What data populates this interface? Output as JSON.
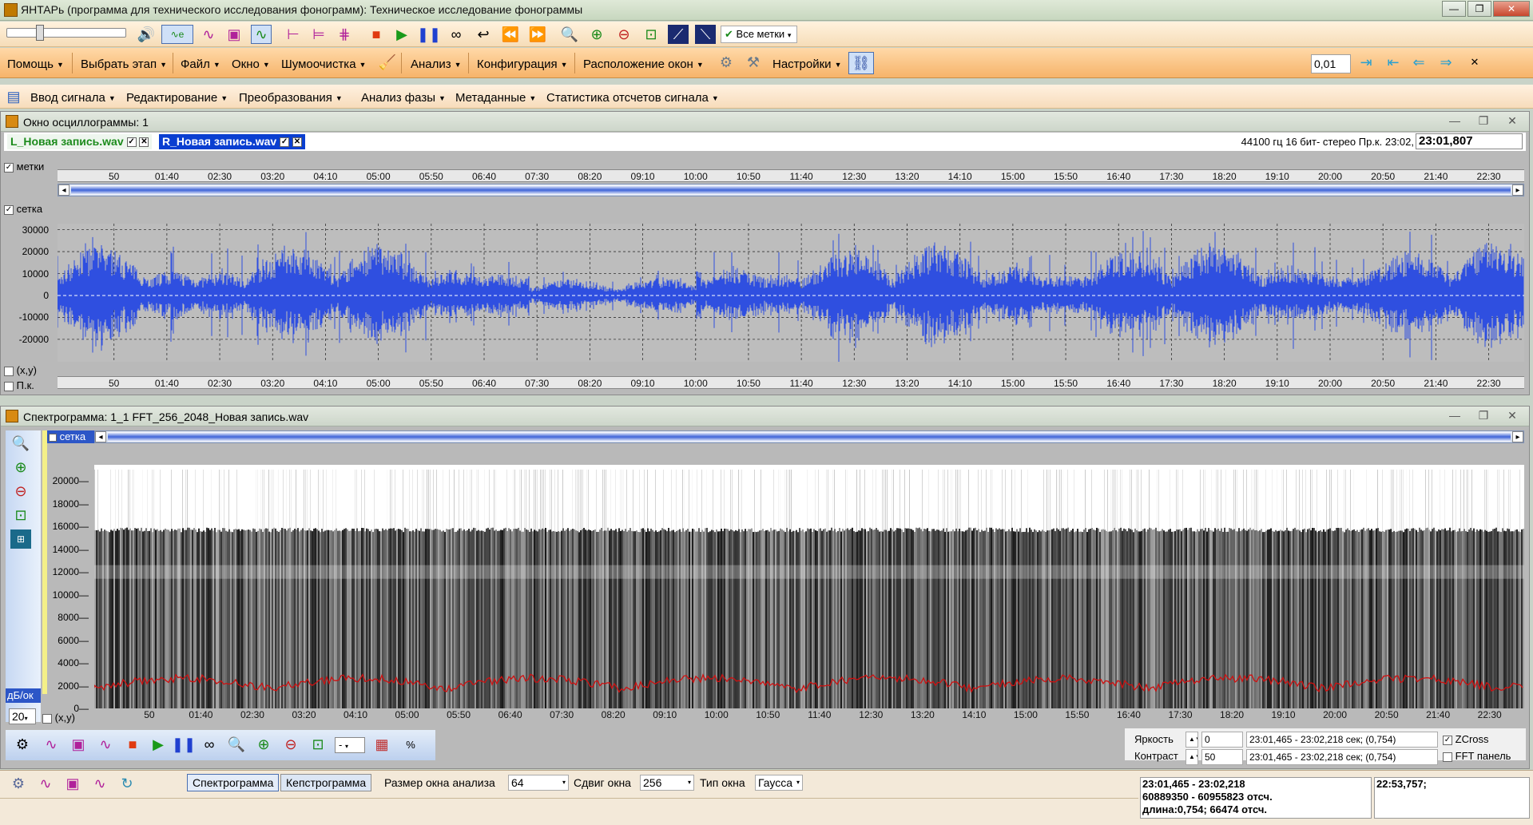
{
  "window": {
    "title": "ЯНТАРь (программа для технического исследования фонограмм): Техническое исследование фонограммы"
  },
  "toolbar1": {
    "marks_dropdown": "Все метки"
  },
  "menu": {
    "items": [
      "Помощь",
      "Выбрать этап",
      "Файл",
      "Окно",
      "Шумоочистка",
      "Анализ",
      "Конфигурация",
      "Расположение окон",
      "Настройки"
    ],
    "step_value": "0,01"
  },
  "submenu": {
    "items": [
      "Ввод сигнала",
      "Редактирование",
      "Преобразования",
      "Анализ фазы",
      "Метаданные",
      "Статистика отсчетов сигнала"
    ]
  },
  "osc": {
    "title": "Окно осциллограммы: 1",
    "tab_left": "L_Новая запись.wav",
    "tab_right": "R_Новая запись.wav",
    "file_info": "44100 гц 16 бит- стерео Пр.к. 23:02,",
    "time_value": "23:01,807",
    "opt_marks": "метки",
    "opt_grid": "сетка",
    "opt_xy": "(x,y)",
    "opt_pk": "П.к.",
    "y_ticks": [
      "30000",
      "20000",
      "10000",
      "0",
      "-10000",
      "-20000"
    ],
    "time_ticks": [
      "50",
      "01:40",
      "02:30",
      "03:20",
      "04:10",
      "05:00",
      "05:50",
      "06:40",
      "07:30",
      "08:20",
      "09:10",
      "10:00",
      "10:50",
      "11:40",
      "12:30",
      "13:20",
      "14:10",
      "15:00",
      "15:50",
      "16:40",
      "17:30",
      "18:20",
      "19:10",
      "20:00",
      "20:50",
      "21:40",
      "22:30"
    ],
    "wave_color": "#2f4fe0"
  },
  "spec": {
    "title": "Спектрограмма: 1_1  FFT_256_2048_Новая запись.wav",
    "opt_grid": "сетка",
    "opt_xy": "(x,y)",
    "db_label": "дБ/ок",
    "db_value": "20",
    "y_ticks": [
      "20000",
      "18000",
      "16000",
      "14000",
      "12000",
      "10000",
      "8000",
      "6000",
      "4000",
      "2000",
      "0"
    ],
    "time_ticks": [
      "50",
      "01:40",
      "02:30",
      "03:20",
      "04:10",
      "05:00",
      "05:50",
      "06:40",
      "07:30",
      "08:20",
      "09:10",
      "10:00",
      "10:50",
      "11:40",
      "12:30",
      "13:20",
      "14:10",
      "15:00",
      "15:50",
      "16:40",
      "17:30",
      "18:20",
      "19:10",
      "20:00",
      "20:50",
      "21:40",
      "22:30"
    ],
    "brightness_label": "Яркость",
    "brightness_value": "0",
    "contrast_label": "Контраст",
    "contrast_value": "50",
    "range1": "23:01,465 - 23:02,218 сек; (0,754)",
    "range2": "23:01,465 - 23:02,218 сек; (0,754)",
    "zcross_label": "ZCross",
    "fft_panel_label": "FFT панель",
    "zoom_dropdown": "-",
    "curve_color": "#d01010"
  },
  "statusbar": {
    "tab_spectro": "Спектрограмма",
    "tab_cepstro": "Кепстрограмма",
    "window_size_label": "Размер окна анализа",
    "window_size_value": "64",
    "shift_label": "Сдвиг окна",
    "shift_value": "256",
    "type_label": "Тип окна",
    "type_value": "Гаусса",
    "info_line1": "23:01,465 - 23:02,218",
    "info_line2": "60889350 - 60955823 отсч.",
    "info_line3": "длина:0,754; 66474 отсч.",
    "info_right": "22:53,757;"
  }
}
